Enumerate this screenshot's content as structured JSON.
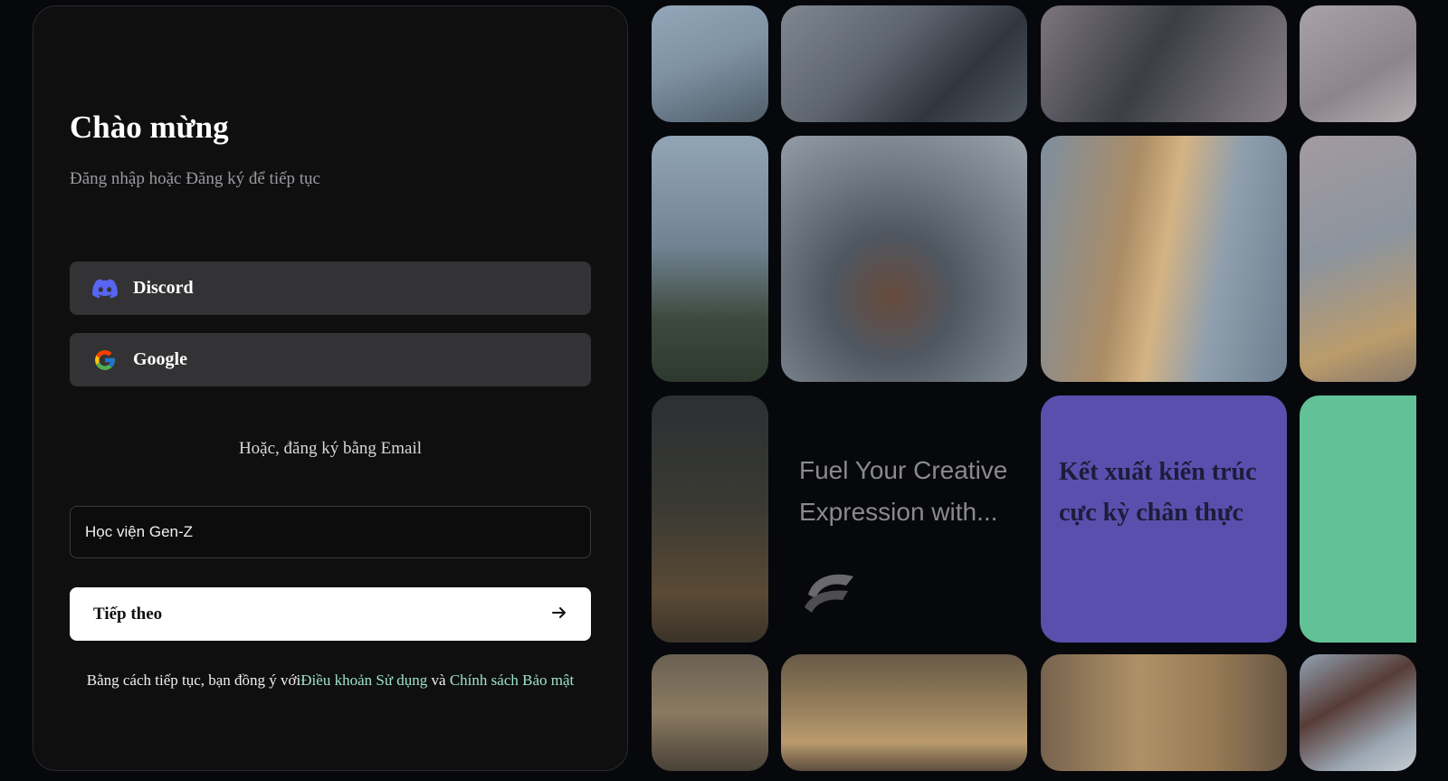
{
  "login": {
    "title": "Chào mừng",
    "subtitle": "Đăng nhập hoặc Đăng ký để tiếp tục",
    "discord_label": "Discord",
    "google_label": "Google",
    "divider": "Hoặc, đăng ký bằng Email",
    "name_value": "Học viện Gen-Z",
    "next_label": "Tiếp theo",
    "terms_prefix": "Bằng cách tiếp tục, bạn đồng ý với",
    "terms_link": "Điều khoản Sử dụng",
    "terms_and": " và ",
    "privacy_link": "Chính sách Bảo mật"
  },
  "gallery": {
    "promo_text": "Fuel Your Creative Expression with...",
    "purple_caption": "Kết xuất kiến trúc cực kỳ chân thực"
  },
  "colors": {
    "discord": "#5865F2",
    "link": "#9ee3c6",
    "purple_tile": "#5b4fae",
    "green_tile": "#62c196"
  },
  "icons": [
    "discord-icon",
    "google-icon",
    "arrow-right-icon",
    "brand-logo-icon"
  ]
}
